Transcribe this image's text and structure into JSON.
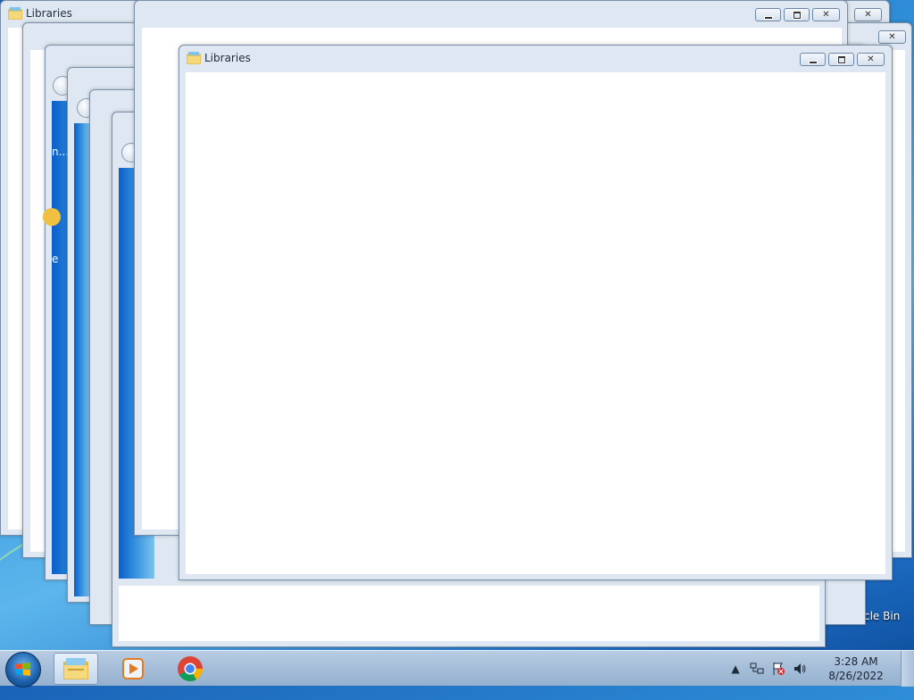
{
  "windows": {
    "title": "Libraries",
    "top_title": "Libraries"
  },
  "desktop": {
    "recycle_bin_label": "cle Bin",
    "fragment_text_1": "n...",
    "fragment_text_2": "e"
  },
  "taskbar": {
    "items": [
      "start-button",
      "windows-explorer",
      "windows-media-player",
      "google-chrome"
    ],
    "clock_time": "3:28 AM",
    "clock_date": "8/26/2022",
    "tray_icons": [
      "show-hidden-icons",
      "network-icon",
      "action-center-icon",
      "volume-icon"
    ]
  },
  "colors": {
    "accent": "#1a63b8",
    "window_frame": "#dfe8f2",
    "taskbar": "#a5bdd8"
  }
}
